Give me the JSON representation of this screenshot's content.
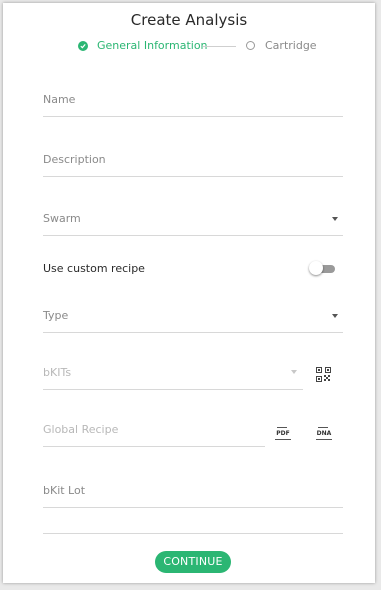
{
  "dialog": {
    "title": "Create Analysis"
  },
  "stepper": {
    "steps": [
      {
        "label": "General Information",
        "state": "active"
      },
      {
        "label": "Cartridge",
        "state": "inactive"
      }
    ]
  },
  "form": {
    "name_label": "Name",
    "description_label": "Description",
    "swarm_label": "Swarm",
    "custom_recipe_label": "Use custom recipe",
    "custom_recipe_enabled": false,
    "type_label": "Type",
    "bkits_label": "bKITs",
    "global_recipe_label": "Global Recipe",
    "pdf_label": "PDF",
    "dna_label": "DNA",
    "bkit_lot_label": "bKit Lot"
  },
  "actions": {
    "continue_label": "CONTINUE"
  },
  "colors": {
    "accent": "#2bb673",
    "muted": "#8a8a8a",
    "disabled": "#b8b8b8"
  },
  "icons": [
    "check-icon",
    "dropdown-caret-icon",
    "qr-code-icon",
    "pdf-icon",
    "dna-icon"
  ]
}
